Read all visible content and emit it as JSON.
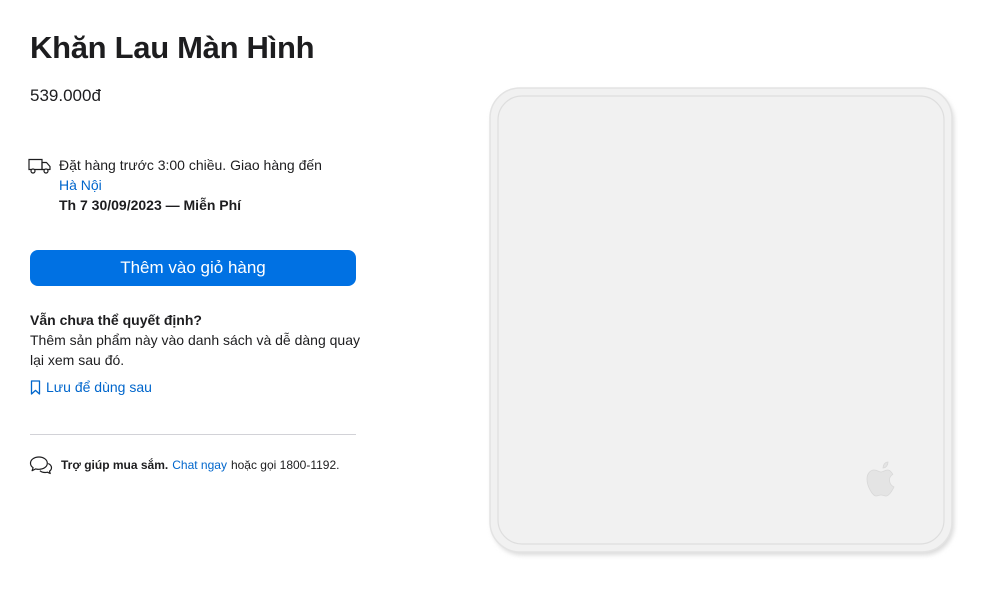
{
  "product": {
    "title": "Khăn Lau Màn Hình",
    "price": "539.000đ",
    "image_icon": "polishing-cloth-image"
  },
  "delivery": {
    "icon": "truck-icon",
    "text": "Đặt hàng trước 3:00 chiều. Giao hàng đến",
    "location": "Hà Nội",
    "date": "Th 7 30/09/2023 — Miễn Phí"
  },
  "actions": {
    "add_to_bag": "Thêm vào giỏ hàng",
    "button_color": "#0071e3"
  },
  "decide": {
    "title": "Vẫn chưa thể quyết định?",
    "body": "Thêm sản phẩm này vào danh sách và dễ dàng quay lại xem sau đó.",
    "save_link": "Lưu để dùng sau",
    "save_icon": "bookmark-icon"
  },
  "help": {
    "icon": "chat-bubbles-icon",
    "label": "Trợ giúp mua sắm.",
    "chat_link": "Chat ngay",
    "phone_text": "hoặc gọi 1800-1192."
  },
  "colors": {
    "link": "#0066cc",
    "text": "#1d1d1f"
  }
}
